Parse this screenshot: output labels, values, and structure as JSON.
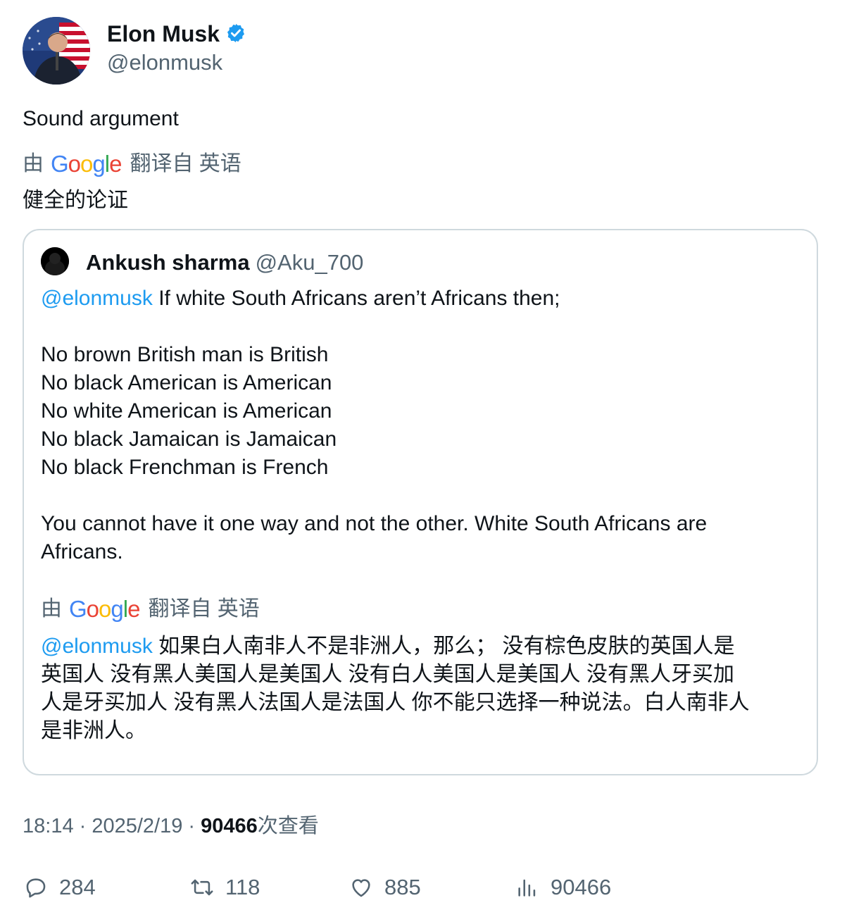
{
  "author": {
    "name": "Elon Musk",
    "handle": "@elonmusk",
    "verified": true,
    "verified_color": "#1d9bf0"
  },
  "tweet": {
    "text": "Sound argument",
    "translation_prefix": "由",
    "translation_provider": "Google",
    "translation_suffix": "翻译自 英语",
    "translated_text": "健全的论证"
  },
  "quote": {
    "name": "Ankush sharma",
    "handle": "@Aku_700",
    "mention": "@elonmusk",
    "first_line_rest": " If white South Africans aren’t Africans then;",
    "lines": [
      "No brown British man is British",
      "No black American is American",
      "No white American is American",
      "No black Jamaican is Jamaican",
      "No black Frenchman is French"
    ],
    "closing_line1": "You cannot have it one way and not the other. White South Africans are",
    "closing_line2": "Africans.",
    "translation_prefix": "由",
    "translation_provider": "Google",
    "translation_suffix": "翻译自 英语",
    "translated_mention": "@elonmusk",
    "translated_lines": [
      " 如果白人南非人不是非洲人，那么； 没有棕色皮肤的英国人是",
      "英国人 没有黑人美国人是美国人 没有白人美国人是美国人 没有黑人牙买加",
      "人是牙买加人 没有黑人法国人是法国人 你不能只选择一种说法。白人南非人",
      "是非洲人。"
    ]
  },
  "meta": {
    "time": "18:14",
    "separator": " · ",
    "date": "2025/2/19",
    "views_count": "90466",
    "views_label": "次查看"
  },
  "actions": {
    "replies": "284",
    "retweets": "118",
    "likes": "885",
    "views": "90466"
  },
  "colors": {
    "accent": "#1d9bf0",
    "secondary_text": "#536471",
    "border": "#cfd9de"
  }
}
